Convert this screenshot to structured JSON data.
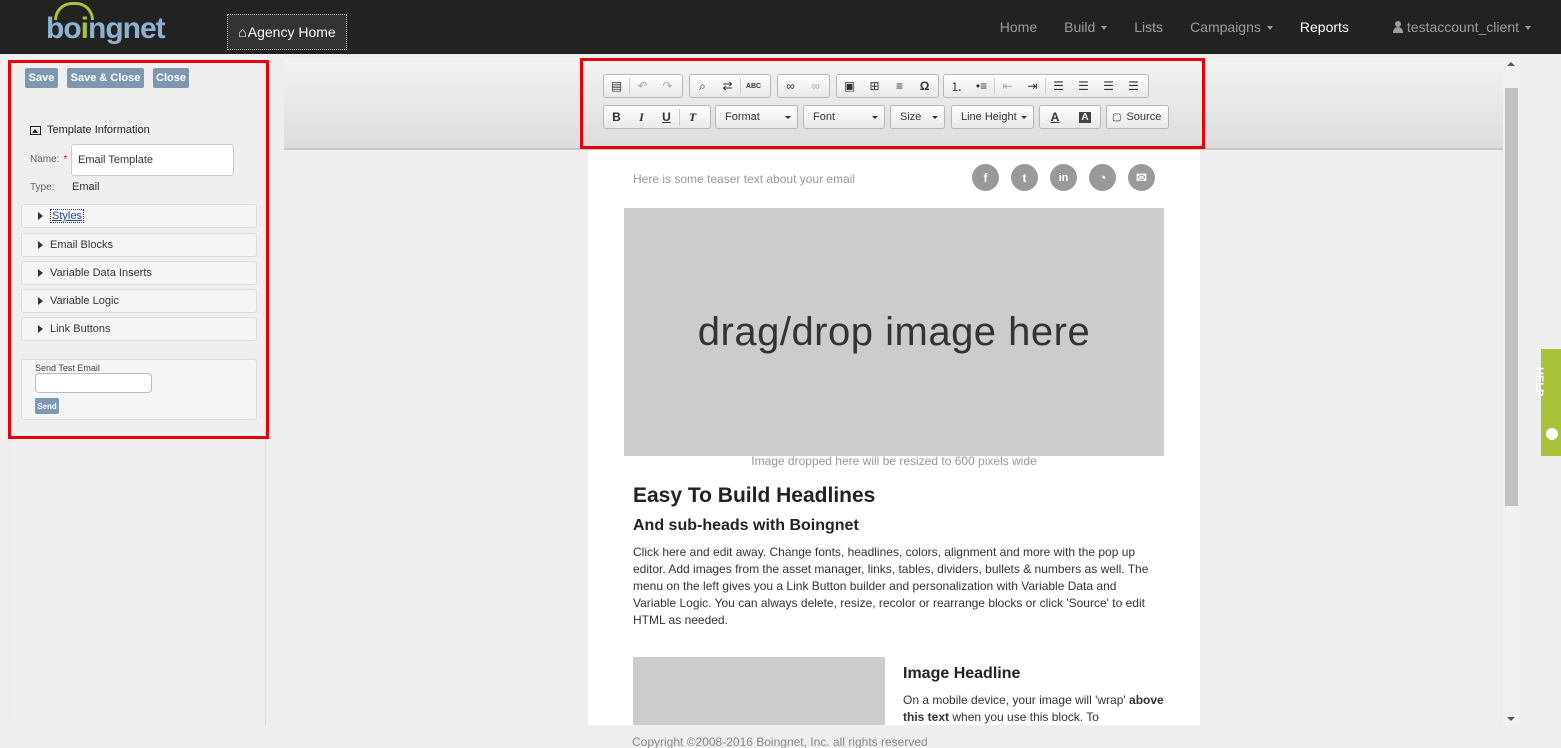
{
  "nav": {
    "logo_left": "bo",
    "logo_right": "ngnet",
    "agency_home": "Agency Home",
    "links": [
      {
        "label": "Home"
      },
      {
        "label": "Build"
      },
      {
        "label": "Lists"
      },
      {
        "label": "Campaigns"
      },
      {
        "label": "Reports"
      }
    ],
    "user": "testaccount_client"
  },
  "sidebar": {
    "buttons": {
      "save": "Save",
      "save_close": "Save & Close",
      "close": "Close"
    },
    "template_info": {
      "title": "Template Information",
      "name_label": "Name:",
      "required_mark": "*",
      "name_value": "Email Template",
      "type_label": "Type:",
      "type_value": "Email"
    },
    "accordion": [
      "Styles",
      "Email Blocks",
      "Variable Data Inserts",
      "Variable Logic",
      "Link Buttons"
    ],
    "send_test": {
      "label": "Send Test Email",
      "input_value": "",
      "button": "Send"
    }
  },
  "toolbar": {
    "format": "Format",
    "font": "Font",
    "size": "Size",
    "line_height": "Line Height",
    "text_color": "A",
    "bg_color": "A",
    "source": "Source",
    "bold": "B",
    "italic": "I",
    "underline": "U",
    "remove_format": "T",
    "spellcheck": "ABC",
    "omega": "Ω"
  },
  "email": {
    "teaser": "Here is some teaser text about your email",
    "social": [
      "f",
      "t",
      "in",
      "rss",
      "mail"
    ],
    "dropzone_text": "drag/drop image here",
    "dropzone_caption": "Image dropped here will be resized to 600 pixels wide",
    "headline": "Easy To Build Headlines",
    "subhead": "And sub-heads with Boingnet",
    "body": "Click here and edit away. Change fonts, headlines, colors, alignment and more with the pop up editor. Add images from the asset manager, links, tables, dividers, bullets & numbers as well. The menu on the left gives you a Link Button builder and personalization with Variable Data and Variable Logic. You can always delete, resize, recolor or rearrange blocks or click 'Source' to edit HTML as needed.",
    "image_headline": "Image Headline",
    "image_text_1": "On a mobile device, your image will 'wrap' ",
    "image_text_bold": "above this text",
    "image_text_2": " when you use this block. To"
  },
  "help_tab": "HELP",
  "footer": "Copyright ©2008-2016 Boingnet, Inc. all rights reserved",
  "colors": {
    "accent_green": "#a8c23a",
    "button_blue": "#7d97ae",
    "highlight_red": "#e8000b",
    "nav_bg": "#222222"
  }
}
